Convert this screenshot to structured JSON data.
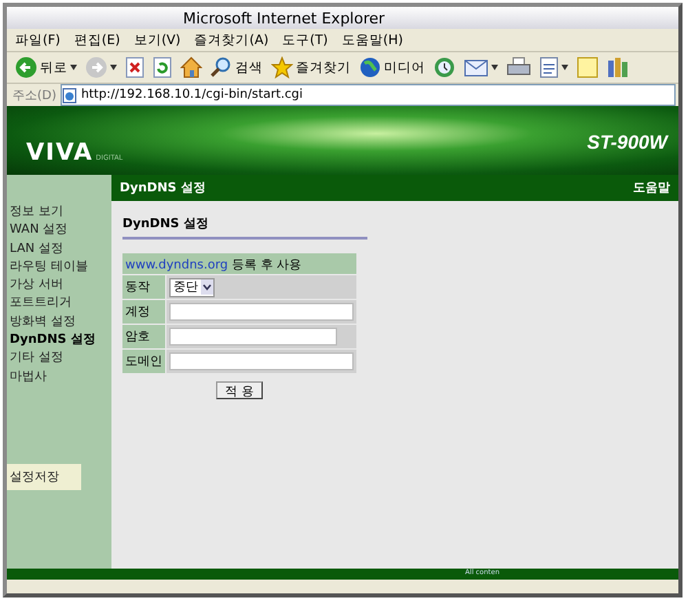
{
  "window": {
    "title": "Microsoft Internet Explorer"
  },
  "menu": [
    "파일(F)",
    "편집(E)",
    "보기(V)",
    "즐겨찾기(A)",
    "도구(T)",
    "도움말(H)"
  ],
  "toolbar": [
    {
      "kind": "back",
      "label": "뒤로",
      "dropdown": true
    },
    {
      "kind": "forward",
      "dropdown": true
    },
    {
      "kind": "stop"
    },
    {
      "kind": "refresh"
    },
    {
      "kind": "home"
    },
    {
      "kind": "search",
      "label": "검색"
    },
    {
      "kind": "favorites",
      "label": "즐겨찾기"
    },
    {
      "kind": "media",
      "label": "미디어"
    },
    {
      "kind": "history"
    },
    {
      "kind": "mail",
      "dropdown": true
    },
    {
      "kind": "print"
    },
    {
      "kind": "edit",
      "dropdown": true
    },
    {
      "kind": "note"
    },
    {
      "kind": "messenger"
    }
  ],
  "address": {
    "label": "주소(D)",
    "value": "http://192.168.10.1/cgi-bin/start.cgi"
  },
  "banner": {
    "logo": "VIVA",
    "logo_sub": "DIGITAL",
    "model": "ST-900W"
  },
  "header": {
    "title": "DynDNS 설정",
    "help": "도움말"
  },
  "sidebar": {
    "items": [
      {
        "label": "정보 보기",
        "selected": false
      },
      {
        "label": "WAN 설정",
        "selected": false
      },
      {
        "label": "LAN 설정",
        "selected": false
      },
      {
        "label": "라우팅 테이블",
        "selected": false
      },
      {
        "label": "가상 서버",
        "selected": false
      },
      {
        "label": "포트트리거",
        "selected": false
      },
      {
        "label": "방화벽 설정",
        "selected": false
      },
      {
        "label": "DynDNS 설정",
        "selected": true
      },
      {
        "label": "기타 설정",
        "selected": false
      },
      {
        "label": "마법사",
        "selected": false
      }
    ],
    "save": "설정저장"
  },
  "form": {
    "title": "DynDNS 설정",
    "note_link": "www.dyndns.org",
    "note": "등록 후 사용",
    "fields": [
      {
        "kind": "select",
        "label": "동작",
        "value": "중단"
      },
      {
        "kind": "text",
        "label": "계정"
      },
      {
        "kind": "password",
        "label": "암호"
      },
      {
        "kind": "text",
        "label": "도메인"
      }
    ],
    "apply": "적 용"
  },
  "footer": "All conten"
}
